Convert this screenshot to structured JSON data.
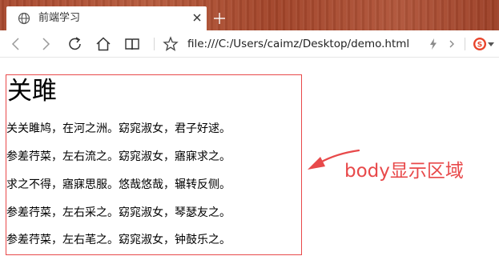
{
  "browser": {
    "tab": {
      "title": "前端学习",
      "icon": "globe-icon"
    },
    "new_tab_icon": "plus-icon",
    "toolbar": {
      "back_icon": "arrow-left-icon",
      "forward_icon": "arrow-right-icon",
      "refresh_icon": "refresh-icon",
      "home_icon": "home-icon",
      "reading_view_icon": "book-icon",
      "favorite_icon": "star-icon",
      "flash_icon": "lightning-icon",
      "more_icon": "chevron-right-icon",
      "extension_icon": "sogou-icon"
    },
    "address": "file:///C:/Users/caimz/Desktop/demo.html",
    "colors": {
      "titlebar": "#a8492f",
      "annotation": "#e8494a",
      "extension": "#e8432a"
    }
  },
  "page": {
    "title": "关雎",
    "lines": [
      "关关雎鸠，在河之洲。窈窕淑女，君子好逑。",
      "参差荇菜，左右流之。窈窕淑女，寤寐求之。",
      "求之不得，寤寐思服。悠哉悠哉，辗转反侧。",
      "参差荇菜，左右采之。窈窕淑女，琴瑟友之。",
      "参差荇菜，左右芼之。窈窕淑女，钟鼓乐之。"
    ]
  },
  "annotation": {
    "label": "body显示区域"
  }
}
